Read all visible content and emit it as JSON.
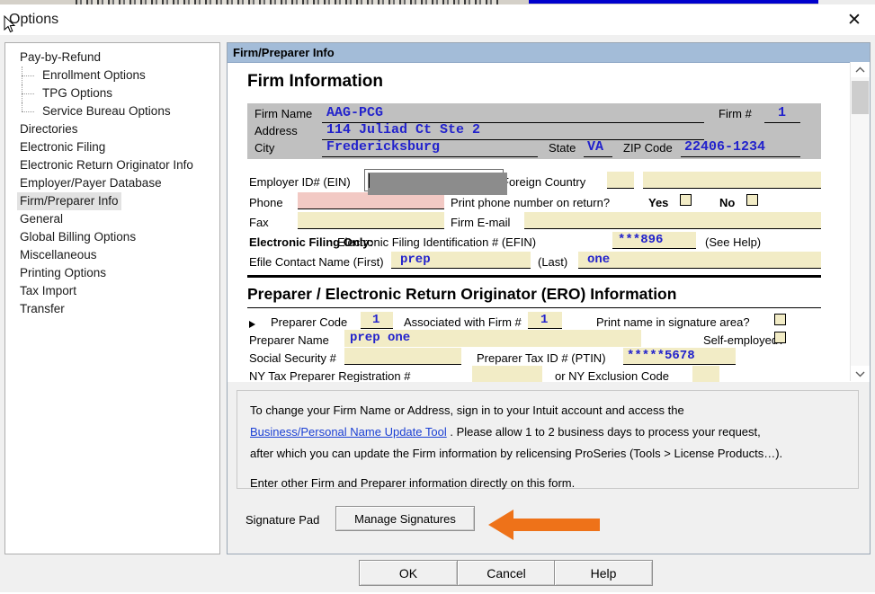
{
  "window": {
    "title": "Options",
    "close_icon": "close-icon"
  },
  "sidebar": {
    "items": [
      {
        "label": "Pay-by-Refund",
        "level": 0,
        "selected": false
      },
      {
        "label": "Enrollment Options",
        "level": 1,
        "selected": false
      },
      {
        "label": "TPG Options",
        "level": 1,
        "selected": false
      },
      {
        "label": "Service Bureau Options",
        "level": 1,
        "selected": false
      },
      {
        "label": "Directories",
        "level": 0,
        "selected": false
      },
      {
        "label": "Electronic Filing",
        "level": 0,
        "selected": false
      },
      {
        "label": "Electronic Return Originator Info",
        "level": 0,
        "selected": false
      },
      {
        "label": "Employer/Payer Database",
        "level": 0,
        "selected": false
      },
      {
        "label": "Firm/Preparer Info",
        "level": 0,
        "selected": true
      },
      {
        "label": "General",
        "level": 0,
        "selected": false
      },
      {
        "label": "Global Billing Options",
        "level": 0,
        "selected": false
      },
      {
        "label": "Miscellaneous",
        "level": 0,
        "selected": false
      },
      {
        "label": "Printing Options",
        "level": 0,
        "selected": false
      },
      {
        "label": "Tax Import",
        "level": 0,
        "selected": false
      },
      {
        "label": "Transfer",
        "level": 0,
        "selected": false
      }
    ]
  },
  "pane": {
    "header": "Firm/Preparer Info",
    "firm_section_title": "Firm Information",
    "ero_section_title": "Preparer / Electronic Return Originator (ERO) Information",
    "firm": {
      "name_label": "Firm Name",
      "name_value": "AAG-PCG",
      "firm_num_label": "Firm #",
      "firm_num_value": "1",
      "address_label": "Address",
      "address_value": "114 Juliad Ct Ste 2",
      "city_label": "City",
      "city_value": "Fredericksburg",
      "state_label": "State",
      "state_value": "VA",
      "zip_label": "ZIP Code",
      "zip_value": "22406-1234",
      "ein_label": "Employer ID# (EIN)",
      "ein_value": "",
      "foreign_country_label": "Foreign Country",
      "phone_label": "Phone",
      "phone_value": "",
      "print_phone_label": "Print phone number on return?",
      "yes_label": "Yes",
      "no_label": "No",
      "fax_label": "Fax",
      "fax_value": "",
      "email_label": "Firm E-mail",
      "email_value": "",
      "efile_only_label": "Electronic Filing Only:",
      "efin_label": "Electronic Filing Identification # (EFIN)",
      "efin_value": "***896",
      "see_help_label": "(See Help)",
      "efile_contact_first_label": "Efile Contact Name (First)",
      "efile_contact_first_value": "prep",
      "efile_contact_last_label": "(Last)",
      "efile_contact_last_value": "one"
    },
    "ero": {
      "preparer_code_label": "Preparer Code",
      "preparer_code_value": "1",
      "associated_firm_label": "Associated with Firm #",
      "associated_firm_value": "1",
      "print_name_label": "Print name in signature area?",
      "preparer_name_label": "Preparer Name",
      "preparer_name_value": "prep one",
      "self_employed_label": "Self-employed?",
      "ssn_label": "Social Security #",
      "ssn_value": "",
      "ptin_label": "Preparer Tax ID # (PTIN)",
      "ptin_value": "*****5678",
      "ny_reg_label": "NY Tax Preparer Registration #",
      "ny_reg_value": "",
      "ny_exclusion_label": "or NY Exclusion Code",
      "ny_exclusion_value": ""
    },
    "scrollbar": {
      "up_icon": "chevron-up-icon",
      "down_icon": "chevron-down-icon"
    }
  },
  "info": {
    "line1": "To change your Firm Name or Address, sign in to your Intuit account and access the",
    "link": "Business/Personal Name Update Tool",
    "line2": ". Please allow 1 to 2 business days to process your request,",
    "line3": "after which you can update the Firm information by relicensing ProSeries (Tools > License Products…).",
    "line4": "Enter other Firm and Preparer information directly on this form."
  },
  "signature": {
    "label": "Signature Pad",
    "button": "Manage Signatures",
    "arrow_icon": "left-arrow-annotation",
    "arrow_color": "#ee7219"
  },
  "footer": {
    "ok": "OK",
    "cancel": "Cancel",
    "help": "Help"
  },
  "colors": {
    "pane_header": "#a3bcd8",
    "field_tint": "#f2ecc6",
    "field_error_tint": "#f2c9c4",
    "firm_block": "#c0c0c0",
    "value_text": "#2222cc",
    "link": "#1a3fd4"
  }
}
